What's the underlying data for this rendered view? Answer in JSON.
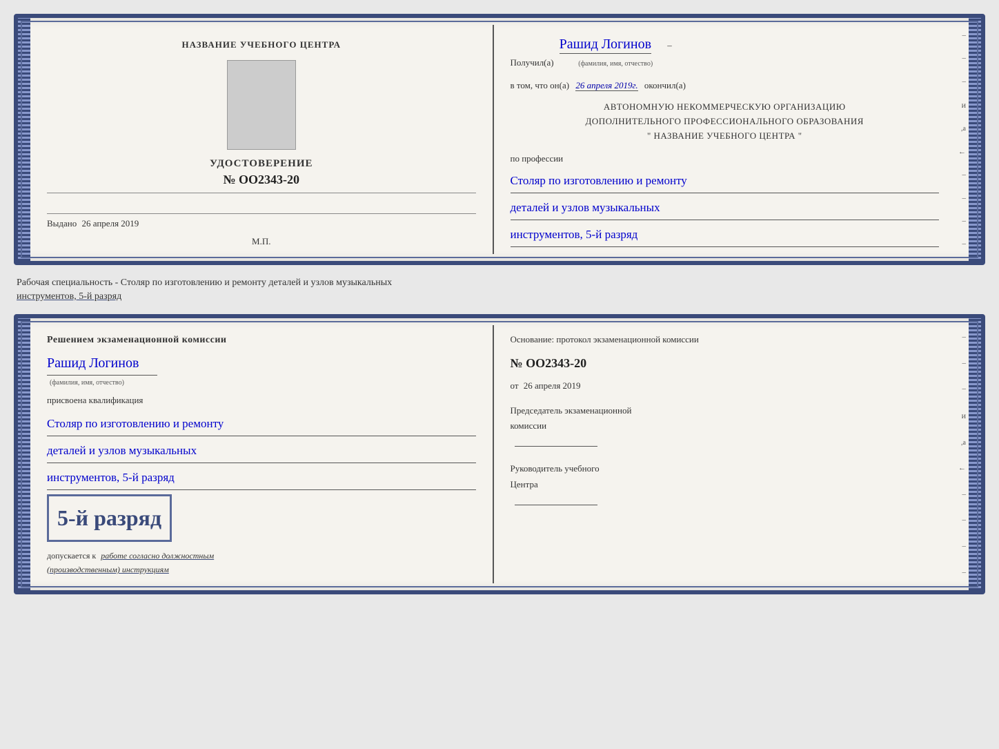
{
  "top_cert": {
    "left": {
      "school_name": "НАЗВАНИЕ УЧЕБНОГО ЦЕНТРА",
      "udostoverenie_label": "УДОСТОВЕРЕНИЕ",
      "cert_number": "№ OO2343-20",
      "issued_label": "Выдано",
      "issued_date": "26 апреля 2019",
      "mp_label": "М.П."
    },
    "right": {
      "recipient_label": "Получил(а)",
      "recipient_name": "Рашид Логинов",
      "fio_label": "(фамилия, имя, отчество)",
      "date_prefix": "в том, что он(а)",
      "date_value": "26 апреля 2019г.",
      "date_suffix": "окончил(а)",
      "org_line1": "АВТОНОМНУЮ НЕКОММЕРЧЕСКУЮ ОРГАНИЗАЦИЮ",
      "org_line2": "ДОПОЛНИТЕЛЬНОГО ПРОФЕССИОНАЛЬНОГО ОБРАЗОВАНИЯ",
      "org_line3": "\" НАЗВАНИЕ УЧЕБНОГО ЦЕНТРА \"",
      "profession_label": "по профессии",
      "profession_line1": "Столяр по изготовлению и ремонту",
      "profession_line2": "деталей и узлов музыкальных",
      "profession_line3": "инструментов, 5-й разряд"
    }
  },
  "specialty_text": {
    "main": "Рабочая специальность - Столяр по изготовлению и ремонту деталей и узлов музыкальных",
    "underlined": "инструментов, 5-й разряд"
  },
  "bottom_cert": {
    "left": {
      "decision_text": "Решением экзаменационной комиссии",
      "person_name": "Рашид Логинов",
      "fio_label": "(фамилия, имя, отчество)",
      "assigned_label": "присвоена квалификация",
      "profession_line1": "Столяр по изготовлению и ремонту",
      "profession_line2": "деталей и узлов музыкальных",
      "profession_line3": "инструментов, 5-й разряд",
      "grade_number": "5-й разряд",
      "allowed_text1": "допускается к",
      "allowed_italic": "работе согласно должностным",
      "allowed_italic2": "(производственным) инструкциям"
    },
    "right": {
      "protocol_label": "Основание: протокол экзаменационной комиссии",
      "protocol_number": "№  OO2343-20",
      "from_label": "от",
      "from_date": "26 апреля 2019",
      "chairman_label": "Председатель экзаменационной",
      "chairman_label2": "комиссии",
      "center_head_label": "Руководитель учебного",
      "center_head_label2": "Центра"
    }
  },
  "dashes": [
    "-",
    "-",
    "-",
    "и",
    ",а",
    "←",
    "-",
    "-",
    "-",
    "-"
  ]
}
